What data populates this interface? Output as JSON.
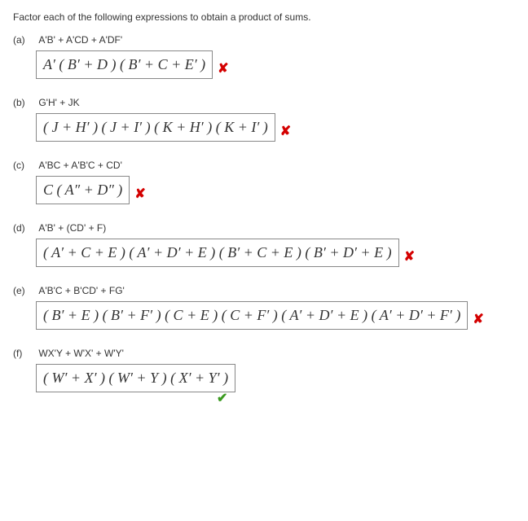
{
  "prompt": "Factor each of the following expressions to obtain a product of sums.",
  "parts": {
    "a": {
      "label": "(a)",
      "expr": "A'B' + A'CD + A'DF'",
      "answer": "A′ ( B′ + D ) ( B′ + C + E′ )",
      "mark": "✘",
      "mark_state": "wrong"
    },
    "b": {
      "label": "(b)",
      "expr": "G'H' + JK",
      "answer": "( J + H′ ) ( J + I′ ) ( K + H′ ) ( K + I′ )",
      "mark": "✘",
      "mark_state": "wrong"
    },
    "c": {
      "label": "(c)",
      "expr": "A'BC + A'B'C + CD'",
      "answer": "C ( A″ + D″ )",
      "mark": "✘",
      "mark_state": "wrong"
    },
    "d": {
      "label": "(d)",
      "expr": "A'B' + (CD' + F)",
      "answer": "( A′ + C + E ) ( A′ + D′ + E ) ( B′ + C + E ) ( B′ + D′ + E )",
      "mark": "✘",
      "mark_state": "wrong"
    },
    "e": {
      "label": "(e)",
      "expr": "A'B'C + B'CD' + FG'",
      "answer": "( B′ + E ) ( B′ + F′ ) ( C + E ) ( C + F′ ) ( A′ + D′ + E ) ( A′ + D′ + F′ )",
      "mark": "✘",
      "mark_state": "wrong"
    },
    "f": {
      "label": "(f)",
      "expr": "WX'Y + W'X' + W'Y'",
      "answer": "( W′ + X′ ) ( W′ + Y ) ( X′ + Y′ )",
      "mark": "✔",
      "mark_state": "correct"
    }
  }
}
